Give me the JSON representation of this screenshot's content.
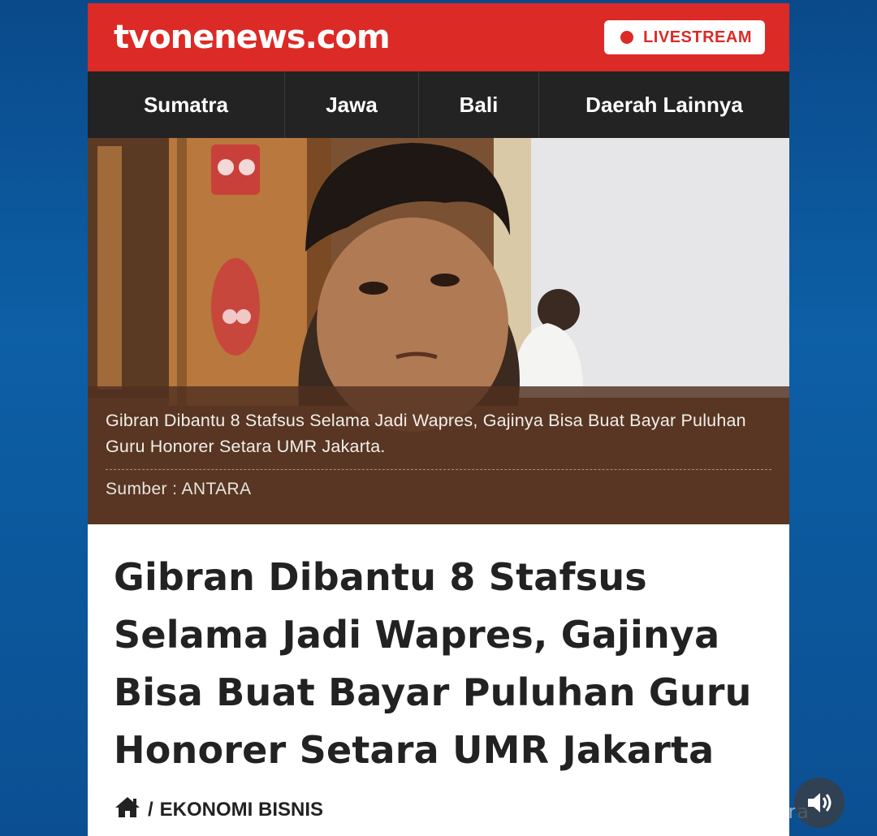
{
  "header": {
    "logo": "tvonenews.com",
    "livestream_label": "LIVESTREAM",
    "brand_color": "#dc2a26"
  },
  "nav": {
    "items": [
      {
        "label": "Sumatra"
      },
      {
        "label": "Jawa"
      },
      {
        "label": "Bali"
      },
      {
        "label": "Daerah Lainnya"
      }
    ]
  },
  "hero": {
    "caption": "Gibran Dibantu 8 Stafsus Selama Jadi Wapres, Gajinya Bisa Buat Bayar Puluhan Guru Honorer Setara UMR Jakarta.",
    "source_label": "Sumber :",
    "source_value": "ANTARA"
  },
  "article": {
    "headline": "Gibran Dibantu 8 Stafsus Selama Jadi Wapres, Gajinya Bisa Buat Bayar Puluhan Guru Honorer Setara UMR Jakarta",
    "breadcrumb_separator": "/",
    "breadcrumb_category": "EKONOMI BISNIS"
  },
  "overlay": {
    "watermark": "@infobimantara",
    "sound_icon": "speaker-icon"
  }
}
